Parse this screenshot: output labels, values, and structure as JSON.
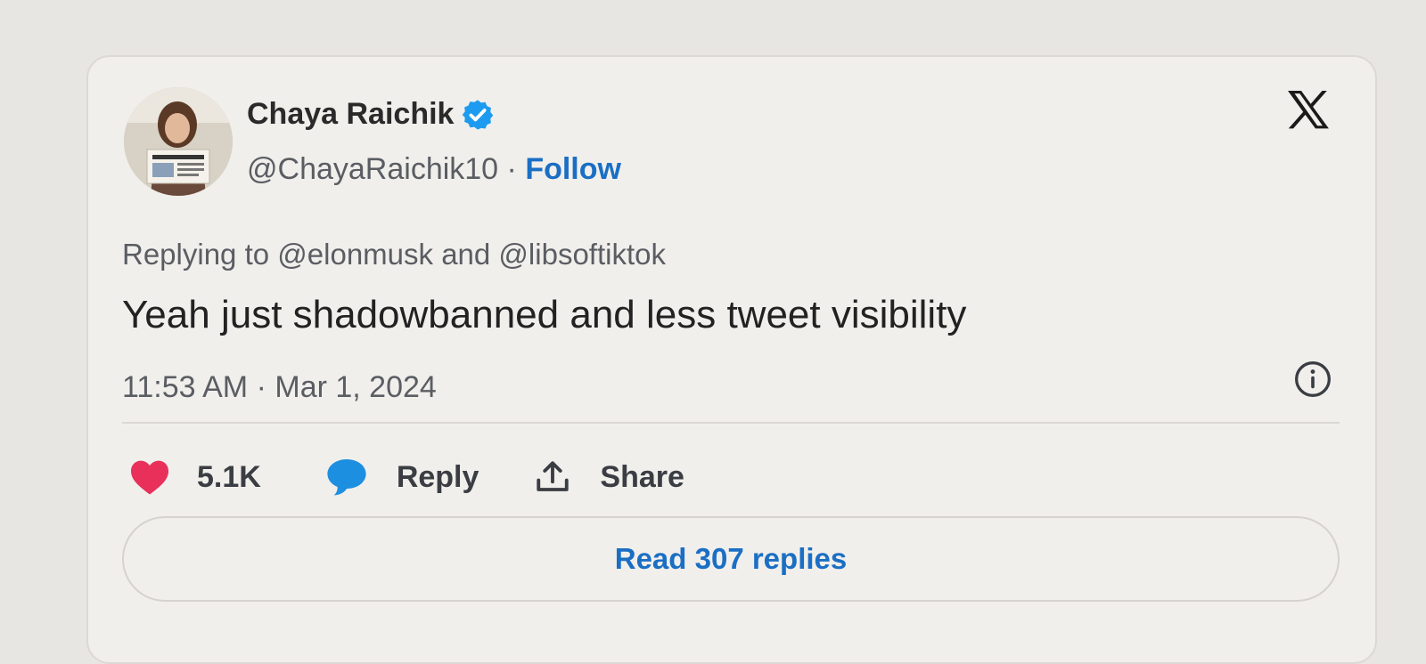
{
  "author": {
    "name": "Chaya Raichik",
    "handle": "@ChayaRaichik10",
    "separator": "·",
    "follow_label": "Follow"
  },
  "reply_context": {
    "prefix": "Replying to",
    "mention_1": "@elonmusk",
    "conjunction": "and",
    "mention_2": "@libsoftiktok"
  },
  "tweet": {
    "text": "Yeah just shadowbanned and less tweet visibility",
    "time": "11:53 AM",
    "separator": "·",
    "date": "Mar 1, 2024"
  },
  "actions": {
    "like_count": "5.1K",
    "reply_label": "Reply",
    "share_label": "Share"
  },
  "read_replies_label": "Read 307 replies",
  "icons": {
    "verified": "verified-badge-icon",
    "x_logo": "x-logo-icon",
    "info": "info-icon",
    "heart": "heart-icon",
    "reply": "speech-bubble-icon",
    "share": "share-upload-icon"
  },
  "colors": {
    "link": "#1a6fc4",
    "heart": "#e8305a",
    "reply_bubble": "#1d8fe0",
    "verified": "#1d9bf0"
  }
}
